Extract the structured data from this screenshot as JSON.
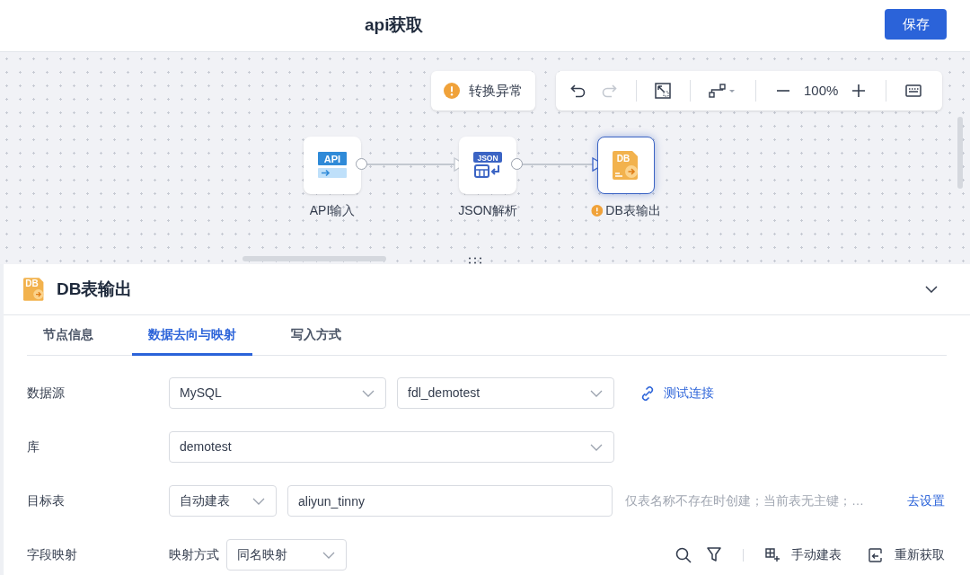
{
  "header": {
    "title": "api获取",
    "save_button": "保存"
  },
  "canvas": {
    "warning": "转换异常",
    "zoom": "100%",
    "nodes": [
      {
        "kind": "api",
        "badge": "API",
        "label": "API输入",
        "selected": false,
        "warning": false
      },
      {
        "kind": "json",
        "badge": "JSON",
        "label": "JSON解析",
        "selected": false,
        "warning": false
      },
      {
        "kind": "db",
        "badge": "DB",
        "label": "DB表输出",
        "selected": true,
        "warning": true
      }
    ]
  },
  "panel": {
    "title": "DB表输出",
    "icon_badge": "DB",
    "tabs": [
      {
        "label": "节点信息",
        "selected": false
      },
      {
        "label": "数据去向与映射",
        "selected": true
      },
      {
        "label": "写入方式",
        "selected": false
      }
    ],
    "rows": [
      {
        "label": "数据源",
        "items": [
          {
            "kind": "select",
            "value": "MySQL"
          },
          {
            "kind": "select",
            "value": "fdl_demotest"
          },
          {
            "kind": "link",
            "text": "测试连接"
          }
        ]
      },
      {
        "label": "库",
        "items": [
          {
            "kind": "wide-select",
            "value": "demotest"
          }
        ]
      },
      {
        "label": "目标表",
        "items": [
          {
            "kind": "short-select",
            "value": "自动建表"
          },
          {
            "kind": "input",
            "value": "aliyun_tinny"
          },
          {
            "kind": "hint",
            "text": "仅表名称不存在时创建；当前表无主键；…"
          },
          {
            "kind": "plain-link",
            "text": "去设置"
          }
        ]
      },
      {
        "label": "字段映射",
        "items": [
          {
            "kind": "text",
            "text": "映射方式"
          },
          {
            "kind": "short-select",
            "value": "同名映射"
          }
        ],
        "tools": [
          {
            "kind": "search"
          },
          {
            "kind": "filter"
          },
          {
            "kind": "divider"
          },
          {
            "kind": "table",
            "text": "手动建表"
          },
          {
            "kind": "refresh",
            "text": "重新获取"
          }
        ]
      }
    ]
  }
}
